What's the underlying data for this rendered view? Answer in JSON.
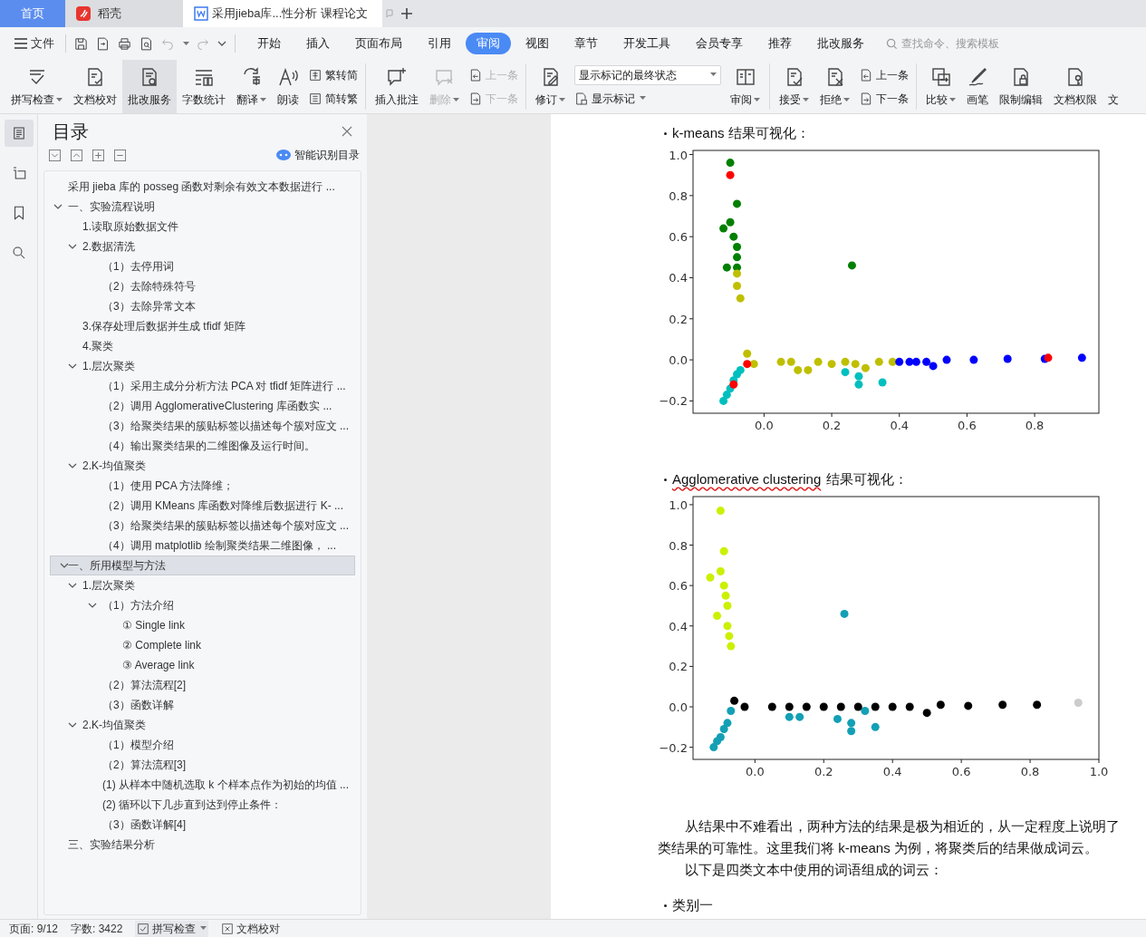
{
  "title_tabs": [
    {
      "kind": "home",
      "label": "首页",
      "selected": false
    },
    {
      "kind": "app",
      "label": "稻壳",
      "selected": false
    },
    {
      "kind": "doc",
      "label": "采用jieba库...性分析 课程论文",
      "selected": true
    }
  ],
  "menu": {
    "file": "文件",
    "tabs": [
      {
        "label": "开始",
        "selected": false
      },
      {
        "label": "插入",
        "selected": false
      },
      {
        "label": "页面布局",
        "selected": false
      },
      {
        "label": "引用",
        "selected": false
      },
      {
        "label": "审阅",
        "selected": true
      },
      {
        "label": "视图",
        "selected": false
      },
      {
        "label": "章节",
        "selected": false
      },
      {
        "label": "开发工具",
        "selected": false
      },
      {
        "label": "会员专享",
        "selected": false
      },
      {
        "label": "推荐",
        "selected": false
      },
      {
        "label": "批改服务",
        "selected": false
      }
    ],
    "search": {
      "placeholder": "查找命令、搜索模板"
    }
  },
  "ribbon": [
    {
      "kind": "big",
      "label": "拼写检查",
      "caret": true,
      "pressed": false,
      "disabled": false
    },
    {
      "kind": "big",
      "label": "文档校对",
      "caret": false,
      "pressed": false,
      "disabled": false
    },
    {
      "kind": "big",
      "label": "批改服务",
      "caret": false,
      "pressed": true,
      "disabled": false
    },
    {
      "kind": "big",
      "label": "字数统计",
      "caret": false,
      "pressed": false,
      "disabled": false
    },
    {
      "kind": "big",
      "label": "翻译",
      "caret": true,
      "pressed": false,
      "disabled": false
    },
    {
      "kind": "big",
      "label": "朗读",
      "caret": false,
      "pressed": false,
      "disabled": false
    },
    {
      "kind": "stack",
      "items": [
        {
          "kind": "button",
          "label": "繁转简",
          "caret": false,
          "disabled": false
        },
        {
          "kind": "button",
          "label": "简转繁",
          "caret": false,
          "disabled": false
        }
      ]
    },
    {
      "kind": "separator"
    },
    {
      "kind": "big",
      "label": "插入批注",
      "caret": false,
      "pressed": false,
      "disabled": false
    },
    {
      "kind": "big",
      "label": "删除",
      "caret": true,
      "pressed": false,
      "disabled": true
    },
    {
      "kind": "stack",
      "items": [
        {
          "kind": "button",
          "label": "上一条",
          "caret": false,
          "disabled": true
        },
        {
          "kind": "button",
          "label": "下一条",
          "caret": false,
          "disabled": true
        }
      ]
    },
    {
      "kind": "separator"
    },
    {
      "kind": "big",
      "label": "修订",
      "caret": true,
      "pressed": false,
      "disabled": false
    },
    {
      "kind": "stack",
      "items": [
        {
          "kind": "field",
          "label": "显示标记的最终状态",
          "caret": true,
          "disabled": false
        },
        {
          "kind": "button",
          "label": "显示标记",
          "caret": true,
          "disabled": false
        }
      ]
    },
    {
      "kind": "big",
      "label": "审阅",
      "caret": true,
      "pressed": false,
      "disabled": false
    },
    {
      "kind": "separator"
    },
    {
      "kind": "big",
      "label": "接受",
      "caret": true,
      "pressed": false,
      "disabled": false
    },
    {
      "kind": "big",
      "label": "拒绝",
      "caret": true,
      "pressed": false,
      "disabled": false
    },
    {
      "kind": "stack",
      "items": [
        {
          "kind": "button",
          "label": "上一条",
          "caret": false,
          "disabled": false
        },
        {
          "kind": "button",
          "label": "下一条",
          "caret": false,
          "disabled": false
        }
      ]
    },
    {
      "kind": "separator"
    },
    {
      "kind": "big",
      "label": "比较",
      "caret": true,
      "pressed": false,
      "disabled": false
    },
    {
      "kind": "big",
      "label": "画笔",
      "caret": false,
      "pressed": false,
      "disabled": false
    },
    {
      "kind": "big",
      "label": "限制编辑",
      "caret": false,
      "pressed": false,
      "disabled": false
    },
    {
      "kind": "big",
      "label": "文档权限",
      "caret": false,
      "pressed": false,
      "disabled": false
    },
    {
      "kind": "big",
      "label": "文",
      "caret": false,
      "pressed": false,
      "disabled": false
    }
  ],
  "nav": {
    "side_icons": [
      {
        "selected": true
      },
      {
        "selected": false
      },
      {
        "selected": false
      },
      {
        "selected": false
      }
    ],
    "title": "目录",
    "smart_toc": "智能识别目录",
    "toc": [
      {
        "text": "采用 jieba 库的 posseg 函数对剩余有效文本数据进行 ...",
        "selected": false
      },
      {
        "text": "一、实验流程说明",
        "selected": false,
        "expanded": true,
        "children": [
          {
            "text": "1.读取原始数据文件",
            "selected": false
          },
          {
            "text": "2.数据清洗",
            "selected": false,
            "expanded": true,
            "children": [
              {
                "text": "（1）去停用词",
                "selected": false
              },
              {
                "text": "（2）去除特殊符号",
                "selected": false
              },
              {
                "text": "（3）去除异常文本",
                "selected": false
              }
            ]
          },
          {
            "text": "3.保存处理后数据并生成 tfidf 矩阵",
            "selected": false
          },
          {
            "text": "4.聚类",
            "selected": false
          },
          {
            "text": "1.层次聚类",
            "selected": false,
            "expanded": true,
            "children": [
              {
                "text": "（1）采用主成分分析方法 PCA 对 tfidf 矩阵进行 ...",
                "selected": false
              },
              {
                "text": "（2）调用 AgglomerativeClustering 库函数实 ...",
                "selected": false
              },
              {
                "text": "（3）给聚类结果的簇贴标签以描述每个簇对应文 ...",
                "selected": false
              },
              {
                "text": "（4）输出聚类结果的二维图像及运行时间。",
                "selected": false
              }
            ]
          },
          {
            "text": "2.K-均值聚类",
            "selected": false,
            "expanded": true,
            "children": [
              {
                "text": "（1）使用 PCA 方法降维；",
                "selected": false
              },
              {
                "text": "（2）调用 KMeans 库函数对降维后数据进行 K- ...",
                "selected": false
              },
              {
                "text": "（3）给聚类结果的簇贴标签以描述每个簇对应文 ...",
                "selected": false
              },
              {
                "text": "（4）调用 matplotlib 绘制聚类结果二维图像， ...",
                "selected": false
              }
            ]
          }
        ]
      },
      {
        "text": "一、所用模型与方法",
        "selected": true,
        "expanded": true,
        "children": [
          {
            "text": "1.层次聚类",
            "selected": false,
            "expanded": true,
            "children": [
              {
                "text": "（1）方法介绍",
                "selected": false,
                "expanded": true,
                "children": [
                  {
                    "text": "① Single link",
                    "selected": false
                  },
                  {
                    "text": "② Complete link",
                    "selected": false
                  },
                  {
                    "text": "③ Average link",
                    "selected": false
                  }
                ]
              },
              {
                "text": "（2）算法流程[2]",
                "selected": false
              },
              {
                "text": "（3）函数详解",
                "selected": false
              }
            ]
          },
          {
            "text": "2.K-均值聚类",
            "selected": false,
            "expanded": true,
            "children": [
              {
                "text": "（1）模型介绍",
                "selected": false
              },
              {
                "text": "（2）算法流程[3]",
                "selected": false
              },
              {
                "text": "(1) 从样本中随机选取 k 个样本点作为初始的均值 ...",
                "selected": false
              },
              {
                "text": "(2) 循环以下几步直到达到停止条件：",
                "selected": false
              },
              {
                "text": "（3）函数详解[4]",
                "selected": false
              }
            ]
          }
        ]
      },
      {
        "text": "三、实验结果分析",
        "selected": false
      }
    ]
  },
  "document": {
    "blocks": [
      {
        "kind": "bullet",
        "text": "k-means 结果可视化："
      },
      {
        "kind": "chart",
        "chart_data": {
          "type": "scatter",
          "xlim": [
            -0.21,
            0.99
          ],
          "ylim": [
            -0.26,
            1.02
          ],
          "xticks": [
            {
              "value": 0,
              "label": "0.0"
            },
            {
              "value": 0.2,
              "label": "0.2"
            },
            {
              "value": 0.4,
              "label": "0.4"
            },
            {
              "value": 0.6,
              "label": "0.6"
            },
            {
              "value": 0.8,
              "label": "0.8"
            }
          ],
          "yticks": [
            {
              "value": -0.2,
              "label": "−0.2"
            },
            {
              "value": 0,
              "label": "0.0"
            },
            {
              "value": 0.2,
              "label": "0.2"
            },
            {
              "value": 0.4,
              "label": "0.4"
            },
            {
              "value": 0.6,
              "label": "0.6"
            },
            {
              "value": 0.8,
              "label": "0.8"
            },
            {
              "value": 1,
              "label": "1.0"
            }
          ],
          "series": [
            {
              "color": "#008000",
              "x": [
                -0.1,
                -0.08,
                -0.1,
                -0.12,
                -0.09,
                -0.08,
                -0.08,
                -0.11,
                -0.08,
                0.26
              ],
              "values": [
                0.96,
                0.76,
                0.67,
                0.64,
                0.6,
                0.55,
                0.5,
                0.45,
                0.45,
                0.46
              ]
            },
            {
              "color": "#bfbf00",
              "x": [
                -0.08,
                -0.08,
                -0.07,
                -0.05,
                -0.03,
                0.05,
                0.08,
                0.1,
                0.13,
                0.16,
                0.2,
                0.24,
                0.27,
                0.3,
                0.34,
                0.38
              ],
              "values": [
                0.42,
                0.36,
                0.3,
                0.03,
                -0.02,
                -0.01,
                -0.01,
                -0.05,
                -0.05,
                -0.01,
                -0.02,
                -0.01,
                -0.02,
                -0.04,
                -0.01,
                -0.01
              ]
            },
            {
              "color": "#0000ff",
              "x": [
                0.4,
                0.43,
                0.45,
                0.48,
                0.5,
                0.54,
                0.62,
                0.72,
                0.83,
                0.94
              ],
              "values": [
                -0.01,
                -0.01,
                -0.01,
                -0.01,
                -0.03,
                0,
                0,
                0.005,
                0.005,
                0.01
              ]
            },
            {
              "color": "#00bfbf",
              "x": [
                -0.12,
                -0.11,
                -0.1,
                -0.09,
                -0.08,
                -0.07,
                0.24,
                0.28,
                0.28,
                0.35
              ],
              "values": [
                -0.2,
                -0.17,
                -0.14,
                -0.1,
                -0.07,
                -0.05,
                -0.06,
                -0.08,
                -0.12,
                -0.11
              ]
            },
            {
              "color": "#ff0000",
              "x": [
                -0.1,
                -0.05,
                -0.09,
                0.84
              ],
              "values": [
                0.9,
                -0.02,
                -0.12,
                0.01
              ]
            }
          ]
        }
      },
      {
        "kind": "bullet",
        "misspelled": "Agglomerative clustering",
        "text": "结果可视化："
      },
      {
        "kind": "chart",
        "chart_data": {
          "type": "scatter",
          "xlim": [
            -0.18,
            1.0
          ],
          "ylim": [
            -0.26,
            1.04
          ],
          "xticks": [
            {
              "value": 0,
              "label": "0.0"
            },
            {
              "value": 0.2,
              "label": "0.2"
            },
            {
              "value": 0.4,
              "label": "0.4"
            },
            {
              "value": 0.6,
              "label": "0.6"
            },
            {
              "value": 0.8,
              "label": "0.8"
            },
            {
              "value": 1,
              "label": "1.0"
            }
          ],
          "yticks": [
            {
              "value": -0.2,
              "label": "−0.2"
            },
            {
              "value": 0,
              "label": "0.0"
            },
            {
              "value": 0.2,
              "label": "0.2"
            },
            {
              "value": 0.4,
              "label": "0.4"
            },
            {
              "value": 0.6,
              "label": "0.6"
            },
            {
              "value": 0.8,
              "label": "0.8"
            },
            {
              "value": 1,
              "label": "1.0"
            }
          ],
          "series": [
            {
              "color": "#ccf000",
              "x": [
                -0.1,
                -0.09,
                -0.1,
                -0.13,
                -0.09,
                -0.085,
                -0.08,
                -0.11,
                -0.08,
                -0.075,
                -0.07
              ],
              "values": [
                0.97,
                0.77,
                0.67,
                0.64,
                0.6,
                0.55,
                0.5,
                0.45,
                0.4,
                0.35,
                0.3
              ]
            },
            {
              "color": "#13a0b5",
              "x": [
                -0.12,
                -0.11,
                -0.1,
                -0.09,
                -0.08,
                -0.07,
                0.1,
                0.13,
                0.24,
                0.28,
                0.28,
                0.32,
                0.35,
                0.26
              ],
              "values": [
                -0.2,
                -0.17,
                -0.15,
                -0.11,
                -0.08,
                -0.02,
                -0.05,
                -0.05,
                -0.06,
                -0.08,
                -0.12,
                -0.02,
                -0.1,
                0.46
              ]
            },
            {
              "color": "#000000",
              "x": [
                -0.06,
                -0.03,
                0.05,
                0.1,
                0.15,
                0.2,
                0.25,
                0.3,
                0.35,
                0.4,
                0.45,
                0.5,
                0.54,
                0.62,
                0.72,
                0.82
              ],
              "values": [
                0.03,
                0,
                0,
                0,
                0,
                0,
                0,
                0,
                0,
                0,
                0,
                -0.03,
                0.01,
                0.005,
                0.01,
                0.01
              ]
            },
            {
              "color": "#cccccc",
              "x": [
                0.94
              ],
              "values": [
                0.02
              ]
            }
          ]
        }
      },
      {
        "kind": "paragraph",
        "lines": [
          "从结果中不难看出，两种方法的结果是极为相近的，从一定程度上说明了",
          "类结果的可靠性。这里我们将 k-means 为例，将聚类后的结果做成词云。"
        ]
      },
      {
        "kind": "paragraph",
        "lines": [
          "以下是四类文本中使用的词语组成的词云："
        ]
      },
      {
        "kind": "bullet",
        "text": "类别一"
      }
    ]
  },
  "status_bar": {
    "page": "页面: 9/12",
    "words": "字数: 3422",
    "spell": "拼写检查",
    "proof": "文档校对"
  }
}
